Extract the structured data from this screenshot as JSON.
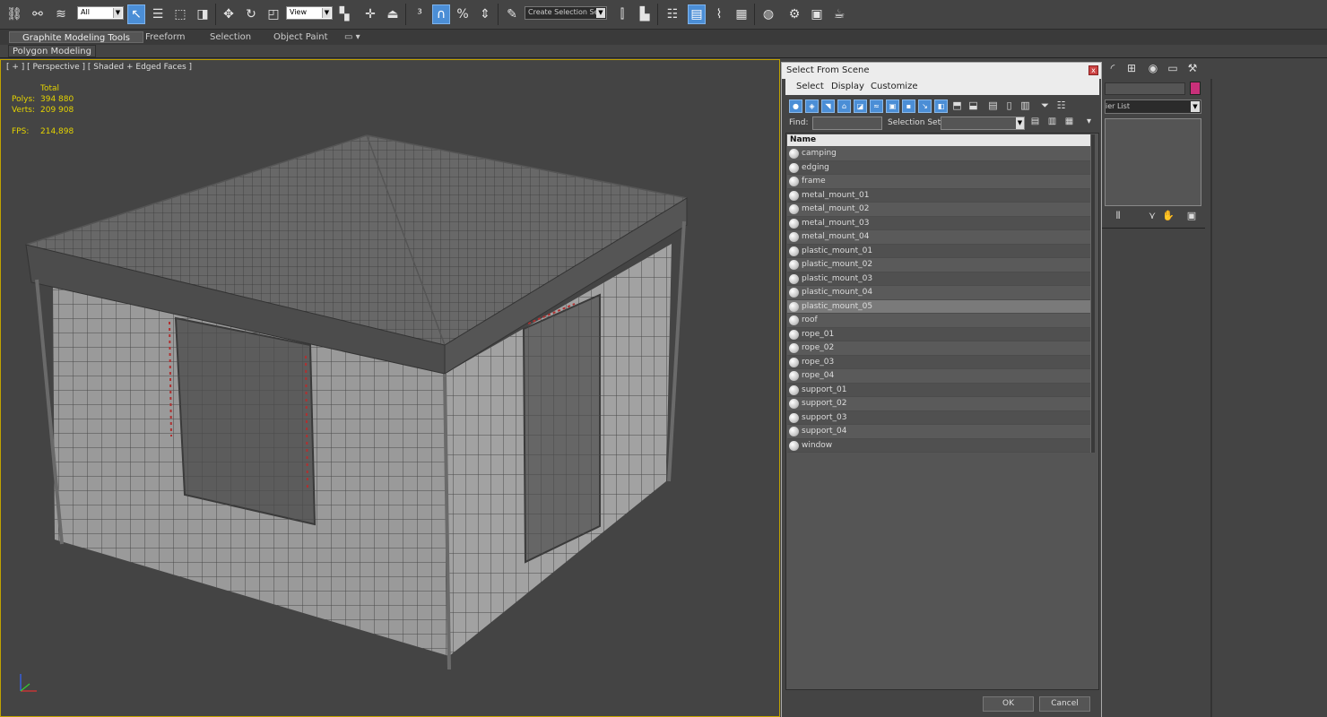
{
  "toolbar": {
    "selection_filter": "All",
    "reference_coord": "View",
    "named_selection": "Create Selection Se"
  },
  "ribbon": {
    "tabs": [
      "Graphite Modeling Tools",
      "Freeform",
      "Selection",
      "Object Paint"
    ],
    "panel_label": "Polygon Modeling"
  },
  "viewport": {
    "label": "[ + ] [ Perspective ] [ Shaded + Edged Faces ]",
    "stats": {
      "total_label": "Total",
      "polys_label": "Polys:",
      "polys_value": "394 880",
      "verts_label": "Verts:",
      "verts_value": "209 908",
      "fps_label": "FPS:",
      "fps_value": "214,898"
    }
  },
  "command_panel": {
    "modifier_list": "ier List",
    "color_swatch": "#c8307a"
  },
  "dialog": {
    "title": "Select From Scene",
    "close_label": "x",
    "menu": [
      "Select",
      "Display",
      "Customize"
    ],
    "find_label": "Find:",
    "selection_set_label": "Selection Set:",
    "list_header": "Name",
    "objects": [
      "camping",
      "edging",
      "frame",
      "metal_mount_01",
      "metal_mount_02",
      "metal_mount_03",
      "metal_mount_04",
      "plastic_mount_01",
      "plastic_mount_02",
      "plastic_mount_03",
      "plastic_mount_04",
      "plastic_mount_05",
      "roof",
      "rope_01",
      "rope_02",
      "rope_03",
      "rope_04",
      "support_01",
      "support_02",
      "support_03",
      "support_04",
      "window"
    ],
    "selected_object": "plastic_mount_05",
    "ok_label": "OK",
    "cancel_label": "Cancel"
  }
}
